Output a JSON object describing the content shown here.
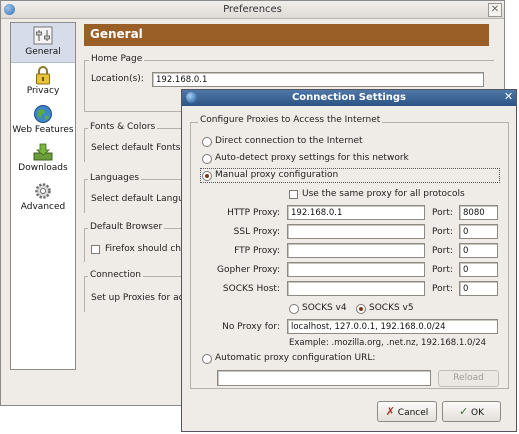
{
  "preferences": {
    "title": "Preferences",
    "close_glyph": "✕",
    "sidebar": [
      {
        "label": "General",
        "icon": "general-sliders-icon"
      },
      {
        "label": "Privacy",
        "icon": "padlock-icon"
      },
      {
        "label": "Web Features",
        "icon": "globe-icon"
      },
      {
        "label": "Downloads",
        "icon": "downloads-tray-icon"
      },
      {
        "label": "Advanced",
        "icon": "gear-icon"
      }
    ],
    "header": "General",
    "home_page": {
      "group": "Home Page",
      "location_label": "Location(s):",
      "location_value": "192.168.0.1"
    },
    "fonts": {
      "group": "Fonts & Colors",
      "text": "Select default Fonts"
    },
    "languages": {
      "group": "Languages",
      "text": "Select default Langu"
    },
    "default_browser": {
      "group": "Default Browser",
      "text": "Firefox should che"
    },
    "connection": {
      "group": "Connection",
      "text": "Set up Proxies for ac"
    }
  },
  "connection_settings": {
    "title": "Connection Settings",
    "close_glyph": "✕",
    "group": "Configure Proxies to Access the Internet",
    "options": {
      "direct": "Direct connection to the Internet",
      "autodetect": "Auto-detect proxy settings for this network",
      "manual": "Manual proxy configuration",
      "auto_url": "Automatic proxy configuration URL:"
    },
    "selected_option": "manual",
    "same_proxy_label": "Use the same proxy for all protocols",
    "same_proxy_checked": false,
    "port_label": "Port:",
    "proxies": [
      {
        "label": "HTTP Proxy:",
        "host": "192.168.0.1",
        "port": "8080"
      },
      {
        "label": "SSL Proxy:",
        "host": "",
        "port": "0"
      },
      {
        "label": "FTP Proxy:",
        "host": "",
        "port": "0"
      },
      {
        "label": "Gopher Proxy:",
        "host": "",
        "port": "0"
      },
      {
        "label": "SOCKS Host:",
        "host": "",
        "port": "0"
      }
    ],
    "socks_v4": "SOCKS v4",
    "socks_v5": "SOCKS v5",
    "socks_selected": "v5",
    "no_proxy_label": "No Proxy for:",
    "no_proxy_value": "localhost, 127.0.0.1, 192.168.0.0/24",
    "example_text": "Example: .mozilla.org, .net.nz, 192.168.1.0/24",
    "auto_url_value": "",
    "reload_label": "Reload",
    "cancel_label": "Cancel",
    "ok_label": "OK"
  }
}
